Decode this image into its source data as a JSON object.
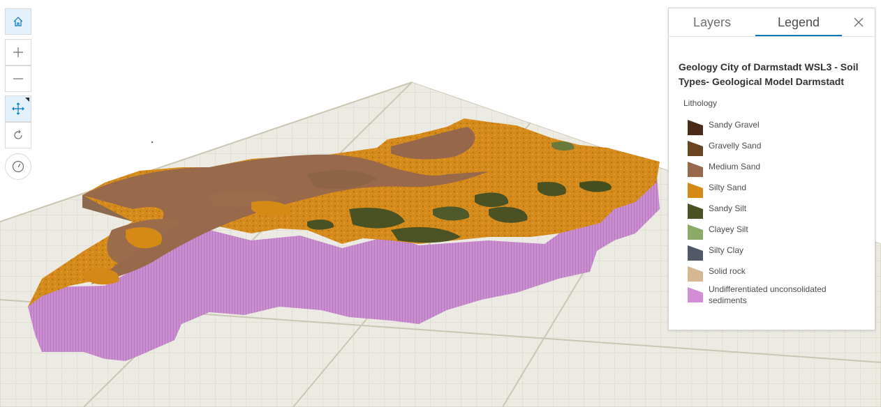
{
  "tabs": {
    "layers": "Layers",
    "legend": "Legend"
  },
  "legend": {
    "title": "Geology City of Darmstadt WSL3 - Soil Types- Geological Model Darmstadt",
    "subtitle": "Lithology",
    "items": [
      {
        "label": "Sandy Gravel",
        "color": "#4a2a16"
      },
      {
        "label": "Gravelly Sand",
        "color": "#6a4420"
      },
      {
        "label": "Medium Sand",
        "color": "#98694a"
      },
      {
        "label": "Silty Sand",
        "color": "#d68a16"
      },
      {
        "label": "Sandy Silt",
        "color": "#4a5224"
      },
      {
        "label": "Clayey Silt",
        "color": "#8aaa66"
      },
      {
        "label": "Silty Clay",
        "color": "#505868"
      },
      {
        "label": "Solid rock",
        "color": "#d6b890"
      },
      {
        "label": "Undifferentiated unconsolidated sediments",
        "color": "#d38cd6"
      }
    ]
  },
  "toolbar": {
    "home": "home-icon",
    "zoom_in": "plus-icon",
    "zoom_out": "minus-icon",
    "pan": "move-icon",
    "rotate": "rotate-icon",
    "compass": "compass-icon"
  }
}
